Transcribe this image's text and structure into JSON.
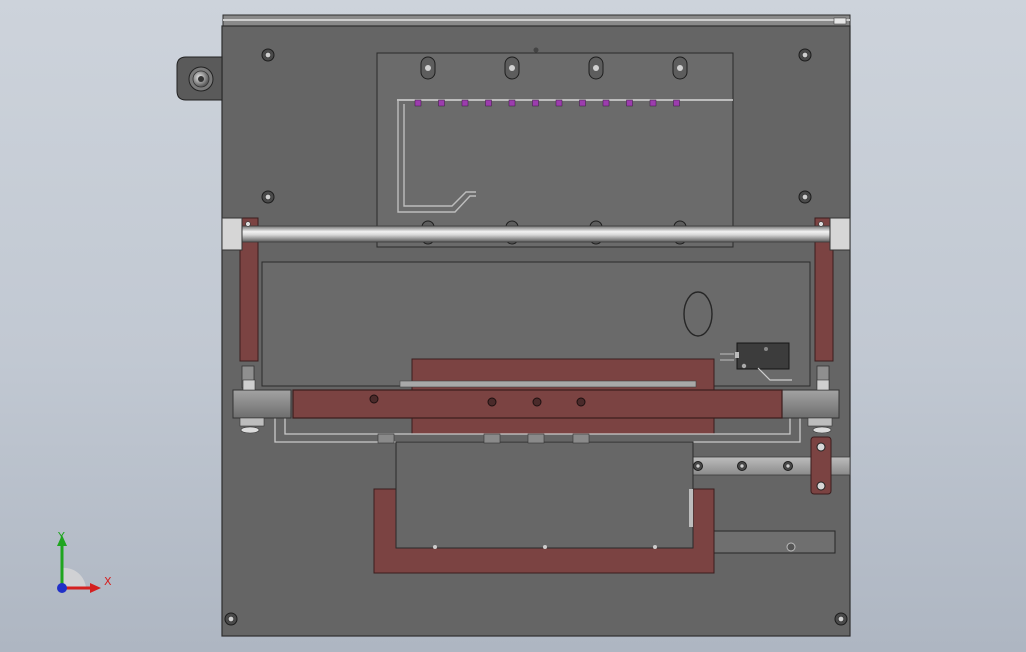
{
  "window": {
    "view_type": "3D CAD model viewport (front view)",
    "background": "#c4cad3"
  },
  "colors": {
    "plate": "#656565",
    "plate_edge": "#2e2e2e",
    "inset": "#6d6d6d",
    "rail_component": "#7b4342",
    "rail_edge": "#3b1d1d",
    "shaft_light": "#eeeeee",
    "shaft_dark": "#7c7c7c",
    "bracket": "#8c8c8c",
    "marker": "#9c3dae",
    "axis_x": "#d42020",
    "axis_y": "#1fa51f",
    "axis_z": "#2030c8"
  },
  "icons": {
    "triad": "coordinate-triad-icon",
    "knob": "knob-icon",
    "switch": "micro-switch-icon"
  },
  "triad": {
    "x_label": "X",
    "y_label": "Y"
  }
}
